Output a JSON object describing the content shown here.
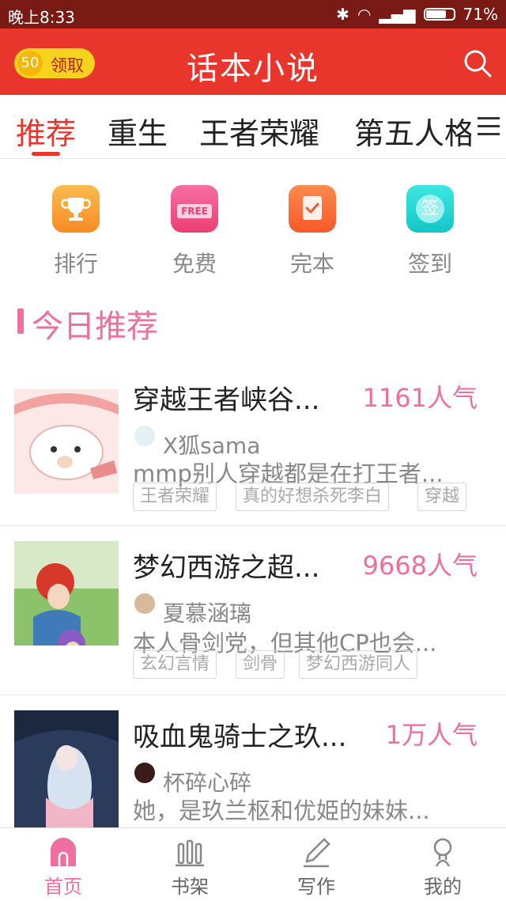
{
  "status_bar": {
    "time": "晚上8:33",
    "battery": "71%"
  },
  "header": {
    "coin_count": "50",
    "coin_label": "领取",
    "title": "话本小说"
  },
  "tabs": [
    "推荐",
    "重生",
    "王者荣耀",
    "第五人格"
  ],
  "quick_actions": [
    {
      "label": "排行",
      "icon": "trophy-icon",
      "color": "#fba33b"
    },
    {
      "label": "免费",
      "icon": "free-sign-icon",
      "color": "#f4508a",
      "icon_text": "FREE"
    },
    {
      "label": "完本",
      "icon": "check-book-icon",
      "color": "#fb6a3b"
    },
    {
      "label": "签到",
      "icon": "sign-in-icon",
      "color": "#22d4cf",
      "icon_text": "签"
    }
  ],
  "section": {
    "title": "今日推荐"
  },
  "books": [
    {
      "title": "穿越王者峡谷...",
      "popularity": "1161人气",
      "author": "X狐sama",
      "desc": "mmp别人穿越都是在打王者...",
      "tags": [
        "王者荣耀",
        "真的好想杀死李白",
        "穿越"
      ]
    },
    {
      "title": "梦幻西游之超...",
      "popularity": "9668人气",
      "author": "夏慕涵璃",
      "desc": "本人骨剑党，但其他CP也会...",
      "tags": [
        "玄幻言情",
        "剑骨",
        "梦幻西游同人"
      ]
    },
    {
      "title": "吸血鬼骑士之玖...",
      "popularity": "1万人气",
      "author": "杯碎心碎",
      "desc": "她，是玖兰枢和优姫的妹妹...",
      "tags": []
    }
  ],
  "bottom_nav": [
    "首页",
    "书架",
    "写作",
    "我的"
  ],
  "colors": {
    "header": "#e8362d",
    "accent_pink": "#ef6fa1",
    "status_bar": "#7a1a14"
  }
}
